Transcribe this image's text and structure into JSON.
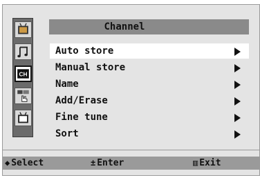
{
  "menu": {
    "title": "Channel",
    "items": [
      {
        "label": "Auto store",
        "selected": true
      },
      {
        "label": "Manual store",
        "selected": false
      },
      {
        "label": "Name",
        "selected": false
      },
      {
        "label": "Add/Erase",
        "selected": false
      },
      {
        "label": "Fine tune",
        "selected": false
      },
      {
        "label": "Sort",
        "selected": false
      }
    ]
  },
  "sidebar": {
    "icons": [
      "tv-picture-icon",
      "sound-music-icon",
      "channel-ch-icon",
      "setup-hand-icon",
      "tv-input-icon"
    ],
    "active": "CH",
    "ch_text": "CH"
  },
  "footer": {
    "select": {
      "icon": "◆",
      "label": "Select"
    },
    "enter": {
      "icon": "±",
      "label": "Enter"
    },
    "exit": {
      "icon": "▥",
      "label": "Exit"
    }
  },
  "colors": {
    "panel": "#e4e4e4",
    "title_bar": "#8a8a8a",
    "footer": "#9a9a9a",
    "selected_row": "#ffffff",
    "text": "#111111"
  }
}
